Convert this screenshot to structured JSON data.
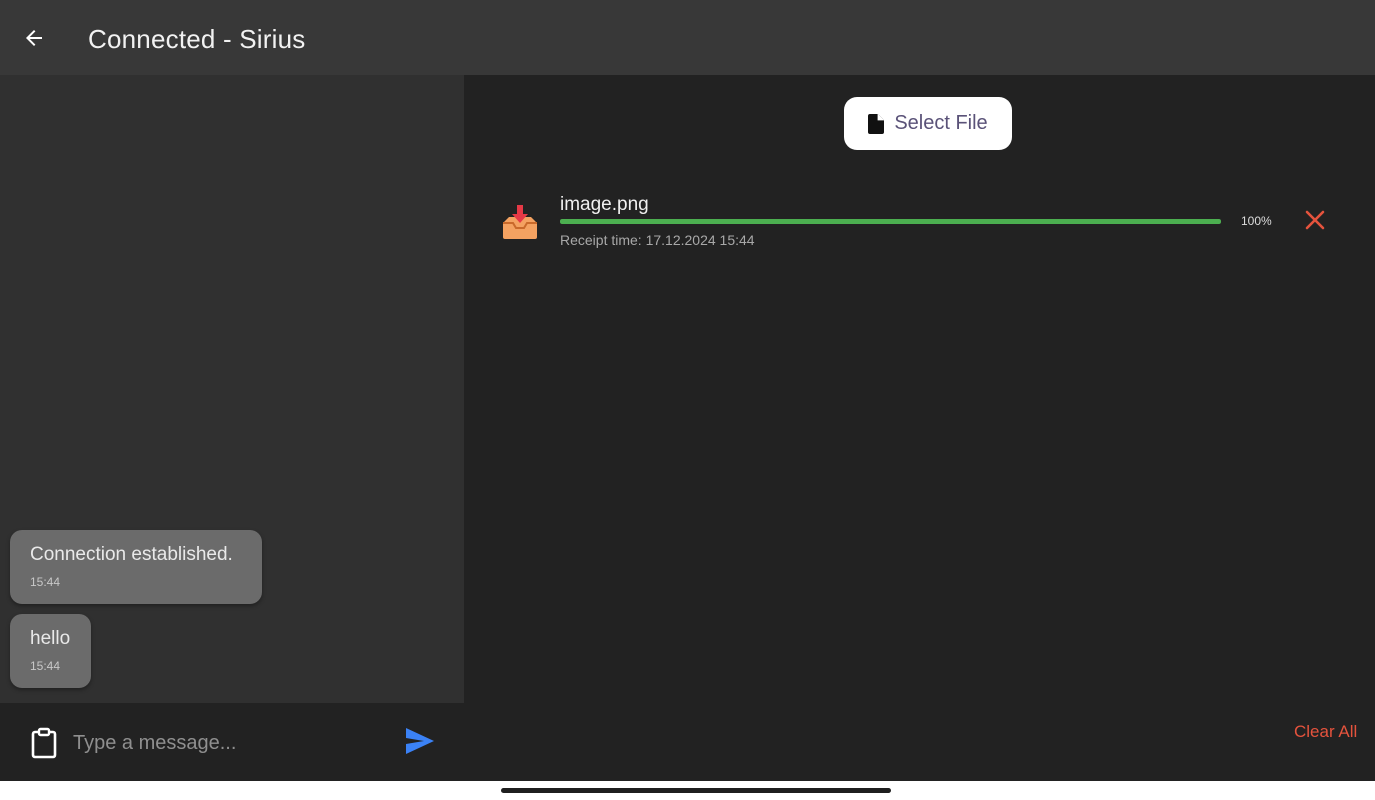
{
  "app_bar": {
    "title": "Connected - Sirius",
    "back_icon": "arrow-left-icon"
  },
  "chat": {
    "messages": [
      {
        "text": "Connection established.",
        "time": "15:44"
      },
      {
        "text": "hello",
        "time": "15:44"
      }
    ],
    "input": {
      "placeholder": "Type a message...",
      "value": ""
    },
    "clipboard_icon": "clipboard-icon",
    "send_icon": "send-icon"
  },
  "files": {
    "select_button_label": "Select File",
    "select_button_icon": "file-icon",
    "items": [
      {
        "name": "image.png",
        "receipt": "Receipt time: 17.12.2024 15:44",
        "progress_label": "100%",
        "progress": 1.0,
        "icon": "inbox-download-icon"
      }
    ],
    "clear_all_label": "Clear All"
  },
  "colors": {
    "appbar": "#383838",
    "chat_panel": "#303030",
    "background": "#222222",
    "bubble": "#6b6b6b",
    "progress": "#4caf50",
    "danger": "#e5533d",
    "send": "#3b82f6"
  }
}
